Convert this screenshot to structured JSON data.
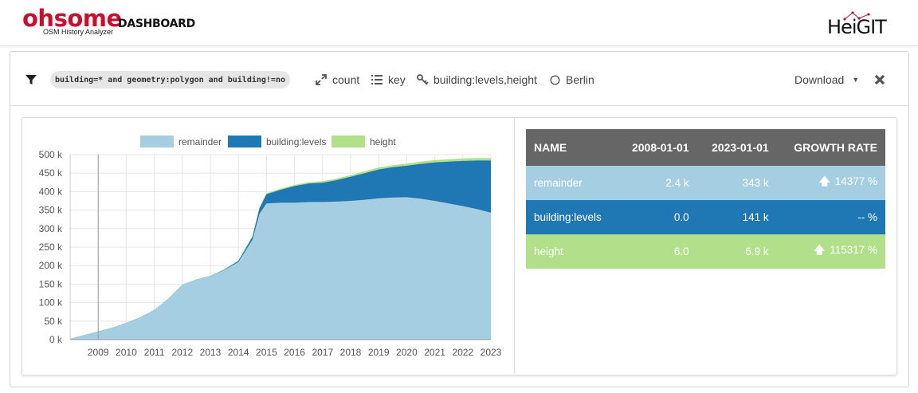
{
  "header": {
    "logo_main": "ohsome",
    "logo_dashboard": "DASHBOARD",
    "logo_sub": "OSM History Analyzer",
    "partner_logo": "HeiGIT"
  },
  "toolbar": {
    "filter_icon": "filter-icon",
    "query": "building=* and geometry:polygon and building!=no",
    "measure": "count",
    "groupby": "key",
    "keys": "building:levels,height",
    "area": "Berlin",
    "download_label": "Download",
    "close_icon": "close-icon"
  },
  "chart_data": {
    "type": "area",
    "stacked": true,
    "legend": [
      "remainder",
      "building:levels",
      "height"
    ],
    "legend_position": "top-center",
    "colors": [
      "#a6cee3",
      "#1f78b4",
      "#b2df8a"
    ],
    "x_ticks": [
      "2009",
      "2010",
      "2011",
      "2012",
      "2013",
      "2014",
      "2015",
      "2016",
      "2017",
      "2018",
      "2019",
      "2020",
      "2021",
      "2022",
      "2023"
    ],
    "y_ticks": [
      "0 k",
      "50 k",
      "100 k",
      "150 k",
      "200 k",
      "250 k",
      "300 k",
      "350 k",
      "400 k",
      "450 k",
      "500 k"
    ],
    "ylim": [
      0,
      500000
    ],
    "x": [
      2008.0,
      2008.5,
      2009.0,
      2009.5,
      2010.0,
      2010.5,
      2011.0,
      2011.5,
      2012.0,
      2012.5,
      2013.0,
      2013.5,
      2014.0,
      2014.5,
      2014.75,
      2015.0,
      2015.5,
      2016.0,
      2016.5,
      2017.0,
      2017.5,
      2018.0,
      2018.5,
      2019.0,
      2019.5,
      2020.0,
      2020.5,
      2021.0,
      2021.5,
      2022.0,
      2022.5,
      2023.0
    ],
    "series": [
      {
        "name": "remainder",
        "values": [
          2400,
          12000,
          22000,
          32000,
          45000,
          60000,
          80000,
          110000,
          148000,
          162000,
          172000,
          188000,
          210000,
          270000,
          340000,
          368000,
          370000,
          370000,
          372000,
          372000,
          373000,
          375000,
          378000,
          382000,
          384000,
          385000,
          381000,
          375000,
          368000,
          361000,
          353000,
          343000
        ]
      },
      {
        "name": "building:levels",
        "values": [
          0,
          0,
          0,
          0,
          0,
          0,
          0,
          0,
          0,
          0,
          0,
          1000,
          3000,
          8000,
          15000,
          25000,
          35000,
          45000,
          50000,
          52000,
          58000,
          65000,
          72000,
          78000,
          82000,
          85000,
          94000,
          104000,
          113000,
          122000,
          131000,
          141000
        ]
      },
      {
        "name": "height",
        "values": [
          6,
          100,
          200,
          300,
          400,
          500,
          600,
          700,
          800,
          900,
          1000,
          1200,
          1400,
          1800,
          2200,
          2600,
          3000,
          3400,
          3700,
          4000,
          4300,
          4600,
          4900,
          5200,
          5500,
          5800,
          6000,
          6200,
          6400,
          6600,
          6800,
          6900
        ]
      }
    ]
  },
  "table": {
    "headers": [
      "NAME",
      "2008-01-01",
      "2023-01-01",
      "GROWTH RATE"
    ],
    "rows": [
      {
        "name": "remainder",
        "start": "2.4 k",
        "end": "343 k",
        "growth": "14377 %",
        "arrow": "up"
      },
      {
        "name": "building:levels",
        "start": "0.0",
        "end": "141 k",
        "growth": "-- %",
        "arrow": "none"
      },
      {
        "name": "height",
        "start": "6.0",
        "end": "6.9 k",
        "growth": "115317 %",
        "arrow": "up"
      }
    ]
  }
}
